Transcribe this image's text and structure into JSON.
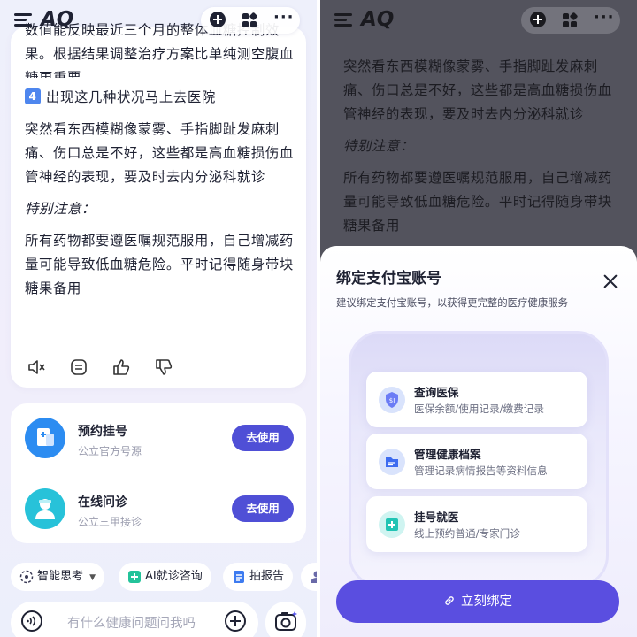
{
  "app": {
    "title": "AQ"
  },
  "chat": {
    "clipped_line": "数值能反映最近三个月的整体血糖控制效果。根据结果调整治疗方案比单纯测空腹血糖更重要",
    "section_number": "4",
    "section_title": "出现这几种状况马上去医院",
    "section_body": "突然看东西模糊像蒙雾、手指脚趾发麻刺痛、伤口总是不好，这些都是高血糖损伤血管神经的表现，要及时去内分泌科就诊",
    "note_title": "特别注意：",
    "note_body": "所有药物都要遵医嘱规范服用，自己增减药量可能导致低血糖危险。平时记得随身带块糖果备用",
    "actions": [
      "speaker-mute-icon",
      "copy-icon",
      "thumbs-up-icon",
      "thumbs-down-icon"
    ]
  },
  "services": [
    {
      "title": "预约挂号",
      "subtitle": "公立官方号源",
      "button": "去使用",
      "icon": "hospital-card-icon",
      "color": "#2c8cf1"
    },
    {
      "title": "在线问诊",
      "subtitle": "公立三甲接诊",
      "button": "去使用",
      "icon": "doctor-icon",
      "color": "#27c2d9"
    }
  ],
  "chips": [
    {
      "label": "智能思考",
      "icon": "think-icon"
    },
    {
      "label": "AI就诊咨询",
      "icon": "ai-consult-icon"
    },
    {
      "label": "拍报告",
      "icon": "report-icon"
    }
  ],
  "input": {
    "placeholder": "有什么健康问题问我吗"
  },
  "sheet": {
    "title": "绑定支付宝账号",
    "subtitle": "建议绑定支付宝账号，以获得更完整的医疗健康服务",
    "features": [
      {
        "title": "查询医保",
        "subtitle": "医保余额/使用记录/缴费记录",
        "icon": "insurance-icon"
      },
      {
        "title": "管理健康档案",
        "subtitle": "管理记录病情报告等资料信息",
        "icon": "folder-icon"
      },
      {
        "title": "挂号就医",
        "subtitle": "线上预约普通/专家门诊",
        "icon": "add-appointment-icon"
      }
    ],
    "button": "立刻绑定"
  },
  "colors": {
    "accent": "#4f4fd6",
    "sheet_button": "#5a4ee0",
    "blue": "#2c8cf1",
    "teal": "#27c2d9"
  }
}
